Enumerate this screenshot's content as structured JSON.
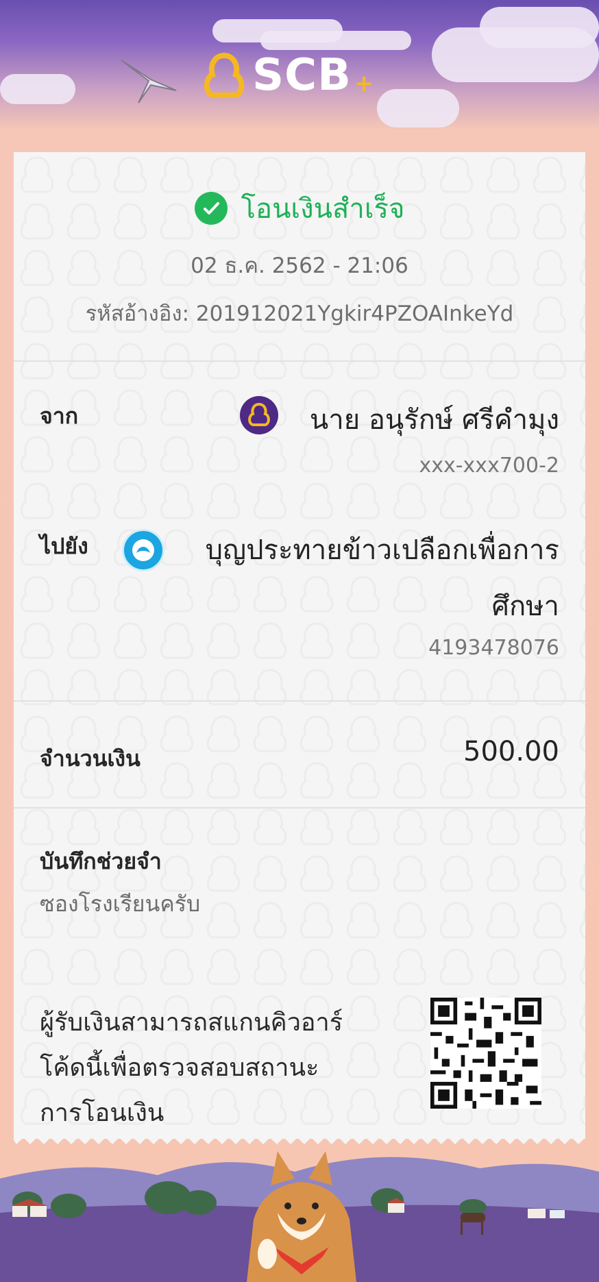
{
  "header": {
    "brand": "SCB",
    "brand_plus": "+"
  },
  "receipt": {
    "status": "โอนเงินสำเร็จ",
    "datetime": "02 ธ.ค. 2562 - 21:06",
    "reference": "รหัสอ้างอิง: 201912021Ygkir4PZOAInkeYd",
    "from": {
      "label": "จาก",
      "name": "นาย อนุรักษ์ ศรีคำมุง",
      "account": "xxx-xxx700-2"
    },
    "to": {
      "label": "ไปยัง",
      "name_line1": "บุญประทายข้าวเปลือกเพื่อการ",
      "name_line2": "ศึกษา",
      "account": "4193478076"
    },
    "amount": {
      "label": "จำนวนเงิน",
      "value": "500.00"
    },
    "memo": {
      "label": "บันทึกช่วยจำ",
      "value": "ซองโรงเรียนครับ"
    },
    "footer": {
      "line1": "ผู้รับเงินสามารถสแกนคิวอาร์",
      "line2": "โค้ดนี้เพื่อตรวจสอบสถานะ",
      "line3": "การโอนเงิน"
    }
  },
  "colors": {
    "success": "#1eb057",
    "scb_purple": "#4e2a84",
    "scb_gold": "#f5b824",
    "ktb_blue": "#1ba5e1"
  },
  "icons": [
    "scb-logo-icon",
    "bird-illustration",
    "check-circle-icon",
    "scb-bank-icon",
    "ktb-bank-icon",
    "qr-code",
    "shiba-dog-illustration"
  ]
}
